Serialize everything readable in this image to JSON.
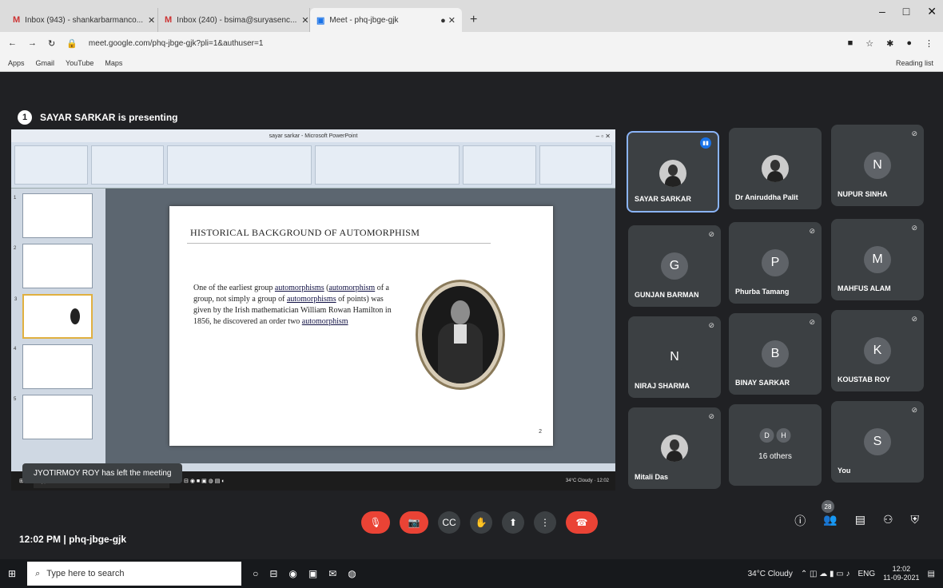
{
  "browser": {
    "tabs": [
      {
        "icon": "M",
        "label": "Inbox (943) - shankarbarmanco..."
      },
      {
        "icon": "M",
        "label": "Inbox (240) - bsima@suryasenc..."
      },
      {
        "icon": "▣",
        "label": "Meet - phq-jbge-gjk"
      }
    ],
    "url": "meet.google.com/phq-jbge-gjk?pli=1&authuser=1",
    "reading_list": "Reading list",
    "bookmarks": [
      "Apps",
      "Gmail",
      "YouTube",
      "Maps"
    ]
  },
  "meet": {
    "presenting_text": "SAYAR SARKAR is presenting",
    "left_toast": "JYOTIRMOY ROY has left the meeting",
    "time": "12:02 PM",
    "code": "phq-jbge-gjk",
    "participants_count": "28",
    "tiles": [
      {
        "name": "SAYAR SARKAR",
        "initial": "",
        "photo": true
      },
      {
        "name": "Dr Aniruddha Palit",
        "initial": "",
        "photo": true
      },
      {
        "name": "NUPUR SINHA",
        "initial": "N",
        "color": "#5f6368"
      },
      {
        "name": "GUNJAN BARMAN",
        "initial": "G",
        "color": "#5f6368"
      },
      {
        "name": "Phurba Tamang",
        "initial": "P",
        "color": "#5f6368"
      },
      {
        "name": "MAHFUS ALAM",
        "initial": "M",
        "color": "#5f6368"
      },
      {
        "name": "NIRAJ SHARMA",
        "initial": "N",
        "color": "#3c4043"
      },
      {
        "name": "BINAY SARKAR",
        "initial": "B",
        "color": "#5f6368"
      },
      {
        "name": "KOUSTAB ROY",
        "initial": "K",
        "color": "#5f6368"
      },
      {
        "name": "Mitali Das",
        "initial": "",
        "photo": true
      },
      {
        "name": "16 others",
        "initial": "",
        "others": true
      },
      {
        "name": "You",
        "initial": "S",
        "color": "#5f6368"
      }
    ]
  },
  "slide": {
    "app_title": "sayar sarkar - Microsoft PowerPoint",
    "title": "HISTORICAL BACKGROUND OF AUTOMORPHISM",
    "body_1": "One of the earliest group ",
    "body_u1": "automorphisms",
    "body_2": " (",
    "body_u2": "automorphism",
    "body_3": " of a group, not simply a group of ",
    "body_u3": "automorphisms",
    "body_4": " of points) was given by the Irish mathematician William Rowan Hamilton in 1856, he discovered an order two ",
    "body_u4": "automorphism",
    "page": "2"
  },
  "taskbar": {
    "search": "Type here to search",
    "weather": "34°C Cloudy",
    "lang": "ENG",
    "time": "12:02",
    "date": "11-09-2021"
  }
}
